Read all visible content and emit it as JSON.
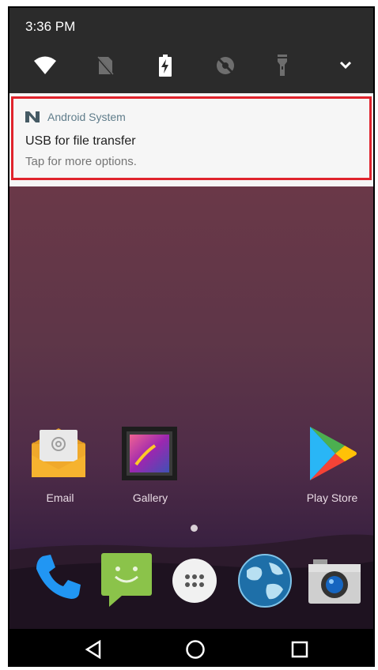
{
  "status_bar": {
    "time": "3:36 PM"
  },
  "quick_settings": [
    {
      "icon": "wifi-icon"
    },
    {
      "icon": "no-sim-icon"
    },
    {
      "icon": "battery-charging-icon"
    },
    {
      "icon": "location-off-icon"
    },
    {
      "icon": "flashlight-icon"
    },
    {
      "icon": "expand-chevron-icon"
    }
  ],
  "notification": {
    "app_name": "Android System",
    "title": "USB for file transfer",
    "text": "Tap for more options.",
    "highlight_color": "#e0232c"
  },
  "home_apps": [
    {
      "label": "Email",
      "icon": "email-icon"
    },
    {
      "label": "Gallery",
      "icon": "gallery-icon"
    },
    {
      "label": "Play Store",
      "icon": "play-store-icon"
    }
  ],
  "dock_apps": [
    {
      "icon": "phone-icon"
    },
    {
      "icon": "messaging-icon"
    },
    {
      "icon": "app-drawer-icon"
    },
    {
      "icon": "browser-icon"
    },
    {
      "icon": "camera-icon"
    }
  ],
  "page_indicator": {
    "pages": 1,
    "current": 1
  },
  "nav_bar": [
    {
      "icon": "back-icon"
    },
    {
      "icon": "home-icon"
    },
    {
      "icon": "recents-icon"
    }
  ]
}
